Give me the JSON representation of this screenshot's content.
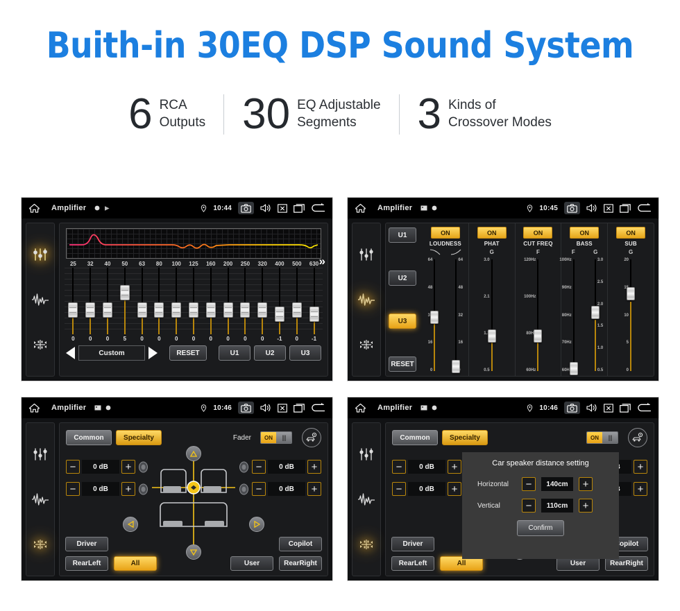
{
  "hero": {
    "title": "Buith-in 30EQ DSP Sound System",
    "color": "#1c7fe0"
  },
  "stats": [
    {
      "number": "6",
      "line1": "RCA",
      "line2": "Outputs"
    },
    {
      "number": "30",
      "line1": "EQ Adjustable",
      "line2": "Segments"
    },
    {
      "number": "3",
      "line1": "Kinds of",
      "line2": "Crossover Modes"
    }
  ],
  "statusbar": {
    "title": "Amplifier",
    "time_p1": "10:44",
    "time_p2": "10:45",
    "time_p3": "10:46",
    "time_p4": "10:46"
  },
  "panel1": {
    "frequencies": [
      "25",
      "32",
      "40",
      "50",
      "63",
      "80",
      "100",
      "125",
      "160",
      "200",
      "250",
      "320",
      "400",
      "500",
      "630"
    ],
    "values": [
      "0",
      "0",
      "0",
      "5",
      "0",
      "0",
      "0",
      "0",
      "0",
      "0",
      "0",
      "0",
      "-1",
      "0",
      "-1"
    ],
    "knob_pct": [
      52,
      52,
      52,
      26,
      52,
      52,
      52,
      52,
      52,
      52,
      52,
      52,
      58,
      52,
      58
    ],
    "preset": "Custom",
    "reset_label": "RESET",
    "user_presets": [
      "U1",
      "U2",
      "U3"
    ],
    "chevron": "»",
    "curve_colors": [
      "#ff2d78",
      "#ff7a18",
      "#ffe000"
    ]
  },
  "panel2": {
    "user_buttons": [
      "U1",
      "U2",
      "U3"
    ],
    "active_user": "U3",
    "reset_label": "RESET",
    "columns": [
      {
        "label": "LOUDNESS",
        "on": "ON",
        "subheads": [
          "",
          ""
        ],
        "sliders": [
          {
            "scale_left": [
              "64",
              "48",
              "32",
              "16",
              "0"
            ],
            "scale_right": [],
            "knob_pct": 46
          },
          {
            "scale_left": [],
            "scale_right": [
              "64",
              "48",
              "32",
              "16",
              "0"
            ],
            "knob_pct": 88
          }
        ]
      },
      {
        "label": "PHAT",
        "on": "ON",
        "subheads": [
          "G"
        ],
        "sliders": [
          {
            "scale_left": [
              "3.0",
              "2.1",
              "1.3",
              "0.5"
            ],
            "scale_right": [],
            "knob_pct": 62
          }
        ]
      },
      {
        "label": "CUT FREQ",
        "on": "ON",
        "subheads": [
          "F"
        ],
        "sliders": [
          {
            "scale_left": [
              "120Hz",
              "100Hz",
              "80Hz",
              "60Hz"
            ],
            "scale_right": [],
            "knob_pct": 62
          }
        ]
      },
      {
        "label": "BASS",
        "on": "ON",
        "subheads": [
          "F",
          "G"
        ],
        "sliders": [
          {
            "scale_left": [
              "100Hz",
              "90Hz",
              "80Hz",
              "70Hz",
              "60Hz"
            ],
            "scale_right": [],
            "knob_pct": 90
          },
          {
            "scale_left": [],
            "scale_right": [
              "3.0",
              "2.5",
              "2.0",
              "1.5",
              "1.0",
              "0.5"
            ],
            "knob_pct": 42
          }
        ]
      },
      {
        "label": "SUB",
        "on": "ON",
        "subheads": [
          "G"
        ],
        "sliders": [
          {
            "scale_left": [
              "20",
              "15",
              "10",
              "5",
              "0"
            ],
            "scale_right": [],
            "knob_pct": 26
          }
        ]
      }
    ]
  },
  "panel3": {
    "tabs": [
      "Common",
      "Specialty"
    ],
    "active_tab": "Specialty",
    "fader_label": "Fader",
    "toggle_state": "ON",
    "levels": [
      "0 dB",
      "0 dB",
      "0 dB",
      "0 dB"
    ],
    "minus": "−",
    "plus": "+",
    "buttons": {
      "driver": "Driver",
      "copilot": "Copilot",
      "rearleft": "RearLeft",
      "all": "All",
      "user": "User",
      "rearright": "RearRight"
    },
    "active_button": "All"
  },
  "dialog": {
    "title": "Car speaker distance setting",
    "rows": [
      {
        "label": "Horizontal",
        "value": "140cm"
      },
      {
        "label": "Vertical",
        "value": "110cm"
      }
    ],
    "confirm": "Confirm",
    "minus": "−",
    "plus": "+"
  }
}
